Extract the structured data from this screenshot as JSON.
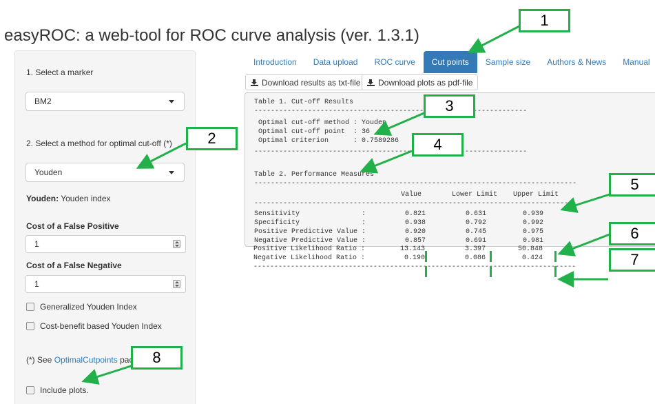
{
  "app": {
    "title": "easyROC: a web-tool for ROC curve analysis (ver. 1.3.1)"
  },
  "sidebar": {
    "marker_label": "1. Select a marker",
    "marker_value": "BM2",
    "method_label": "2. Select a method for optimal cut-off (*)",
    "method_value": "Youden",
    "method_desc_bold": "Youden:",
    "method_desc": "Youden index",
    "cost_fp_label": "Cost of a False Positive",
    "cost_fp_value": "1",
    "cost_fn_label": "Cost of a False Negative",
    "cost_fn_value": "1",
    "gen_youden": "Generalized Youden Index",
    "cost_benefit": "Cost-benefit based Youden Index",
    "footnote_prefix": "(*) See",
    "footnote_link": "OptimalCutpoints",
    "footnote_suffix": "pack",
    "include_plots": "Include plots."
  },
  "tabs": [
    "Introduction",
    "Data upload",
    "ROC curve",
    "Cut points",
    "Sample size",
    "Authors & News",
    "Manual"
  ],
  "active_tab": "Cut points",
  "buttons": {
    "download_txt": "Download results as txt-file",
    "download_pdf": "Download plots as pdf-file"
  },
  "output": {
    "table1_title": "Table 1. Cut-off Results",
    "table1_rows": [
      "Optimal cut-off method : Youden",
      "Optimal cut-off point  : 36",
      "Optimal criterion      : 0.7589286"
    ],
    "table2_title": "Table 2. Performance Measures",
    "columns": [
      "Value",
      "Lower Limit",
      "Upper Limit"
    ],
    "rows": [
      {
        "label": "Sensitivity               :",
        "value": "0.821",
        "lower": "0.631",
        "upper": "0.939"
      },
      {
        "label": "Specificity               :",
        "value": "0.938",
        "lower": "0.792",
        "upper": "0.992"
      },
      {
        "label": "Positive Predictive Value :",
        "value": "0.920",
        "lower": "0.745",
        "upper": "0.975"
      },
      {
        "label": "Negative Predictive Value :",
        "value": "0.857",
        "lower": "0.691",
        "upper": "0.981"
      },
      {
        "label": "Positive Likelihood Ratio :",
        "value": "13.143",
        "lower": "3.397",
        "upper": "50.848"
      },
      {
        "label": "Negative Likelihood Ratio :",
        "value": "0.190",
        "lower": "0.086",
        "upper": "0.424"
      }
    ]
  },
  "annotations": [
    "1",
    "2",
    "3",
    "4",
    "5",
    "6",
    "7",
    "8"
  ],
  "colors": {
    "accent": "#337ab7",
    "annotation": "#22b04a"
  }
}
